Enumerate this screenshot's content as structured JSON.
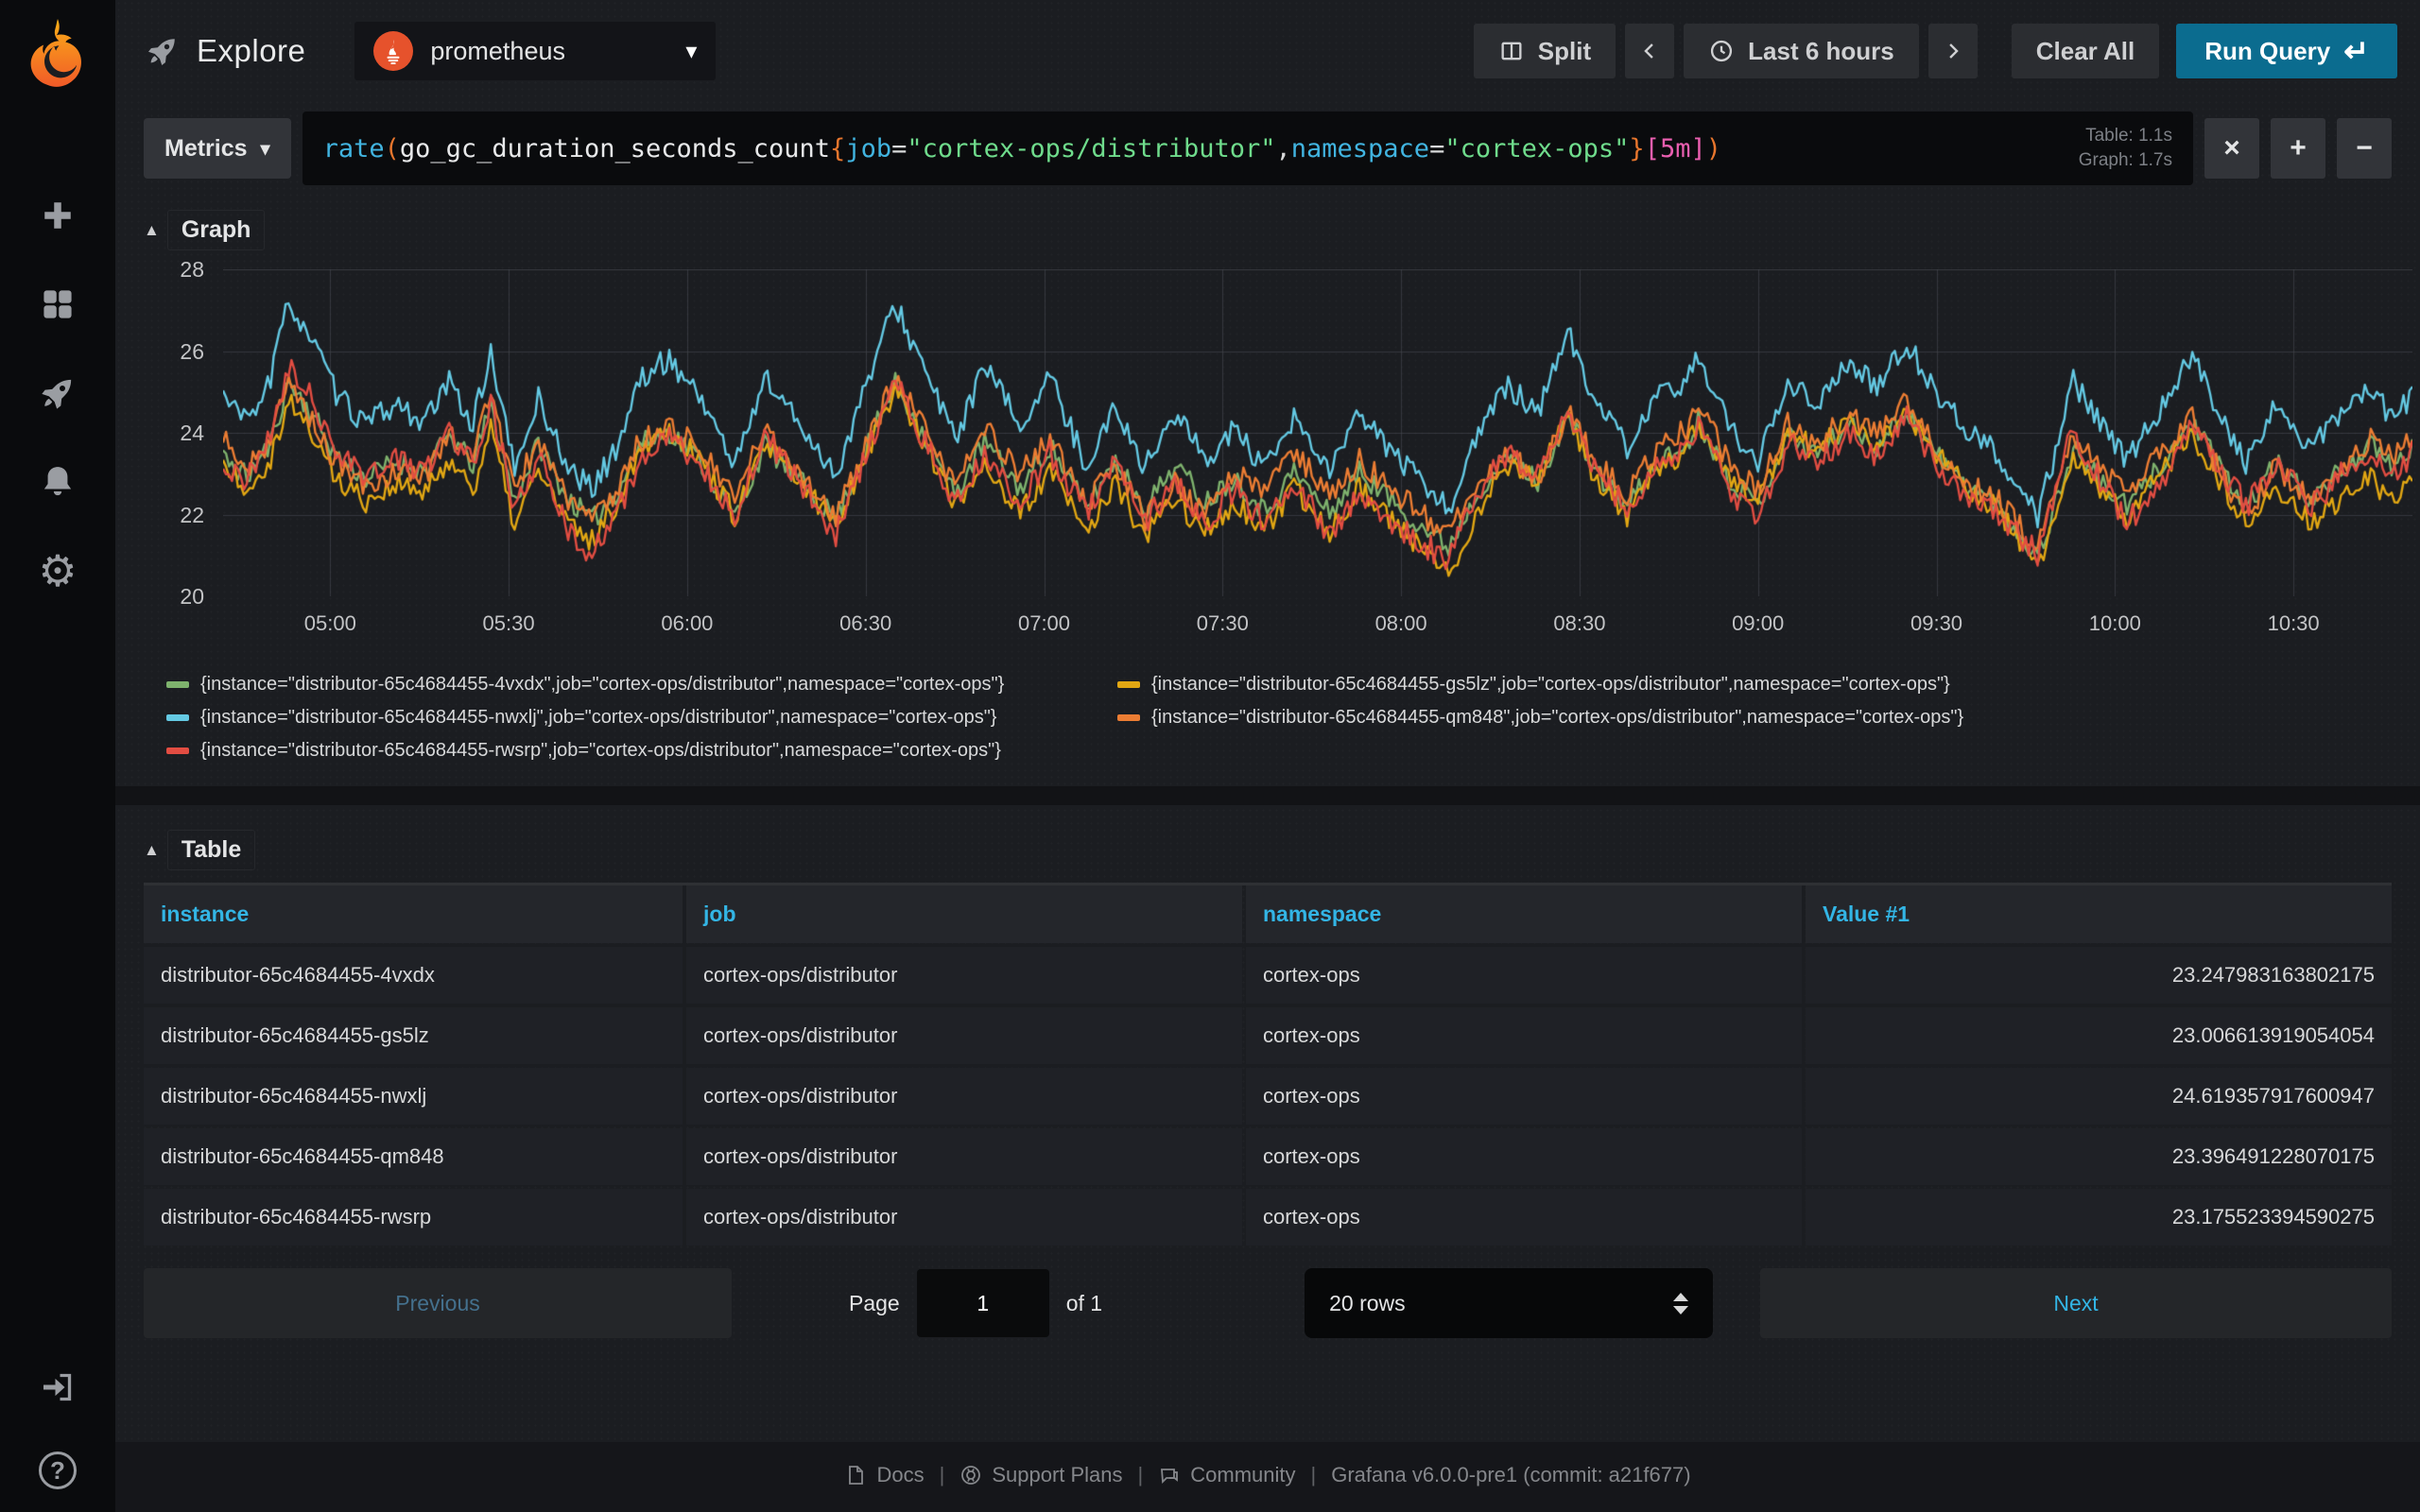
{
  "app": {
    "title": "Explore",
    "datasource": "prometheus"
  },
  "topbar": {
    "split": "Split",
    "time_range": "Last 6 hours",
    "clear_all": "Clear All",
    "run_query": "Run Query",
    "run_query_icon": "↵"
  },
  "query": {
    "mode": "Metrics",
    "mode_caret": "▾",
    "tokens": [
      {
        "t": "rate",
        "c": "func"
      },
      {
        "t": "(",
        "c": "paren"
      },
      {
        "t": "go_gc_duration_seconds_count",
        "c": "metric"
      },
      {
        "t": "{",
        "c": "brace"
      },
      {
        "t": "job",
        "c": "label"
      },
      {
        "t": "=",
        "c": "op"
      },
      {
        "t": "\"cortex-ops/distributor\"",
        "c": "string"
      },
      {
        "t": ",",
        "c": "op"
      },
      {
        "t": "namespace",
        "c": "label"
      },
      {
        "t": "=",
        "c": "op"
      },
      {
        "t": "\"cortex-ops\"",
        "c": "string"
      },
      {
        "t": "}",
        "c": "brace"
      },
      {
        "t": "[5m]",
        "c": "dur"
      },
      {
        "t": ")",
        "c": "paren"
      }
    ],
    "table_time": "Table: 1.1s",
    "graph_time": "Graph: 1.7s",
    "remove_label": "×",
    "add_label": "+",
    "minus_label": "−"
  },
  "graph_section": {
    "collapse_icon": "▲",
    "title": "Graph"
  },
  "chart_data": {
    "type": "line",
    "title": "Graph",
    "ylim": [
      20,
      28
    ],
    "y_ticks": [
      20,
      22,
      24,
      26,
      28
    ],
    "x_ticks": [
      {
        "label": "05:00",
        "minute": 0
      },
      {
        "label": "05:30",
        "minute": 30
      },
      {
        "label": "06:00",
        "minute": 60
      },
      {
        "label": "06:30",
        "minute": 90
      },
      {
        "label": "07:00",
        "minute": 120
      },
      {
        "label": "07:30",
        "minute": 150
      },
      {
        "label": "08:00",
        "minute": 180
      },
      {
        "label": "08:30",
        "minute": 210
      },
      {
        "label": "09:00",
        "minute": 240
      },
      {
        "label": "09:30",
        "minute": 270
      },
      {
        "label": "10:00",
        "minute": 300
      },
      {
        "label": "10:30",
        "minute": 330
      }
    ],
    "x_range_minutes": [
      -18,
      350
    ],
    "grid_color": "#44474e",
    "base_mean": 24.62,
    "anchors": [
      [
        -18,
        24.8
      ],
      [
        -14,
        24.2
      ],
      [
        -10,
        25.2
      ],
      [
        -7,
        27.1
      ],
      [
        -3,
        26.1
      ],
      [
        1,
        24.8
      ],
      [
        6,
        24.1
      ],
      [
        11,
        24.6
      ],
      [
        16,
        24.3
      ],
      [
        20,
        25.4
      ],
      [
        24,
        24.5
      ],
      [
        27,
        26.3
      ],
      [
        31,
        23.3
      ],
      [
        35,
        25.0
      ],
      [
        40,
        23.2
      ],
      [
        44,
        22.6
      ],
      [
        48,
        23.5
      ],
      [
        52,
        25.1
      ],
      [
        57,
        25.6
      ],
      [
        62,
        24.9
      ],
      [
        68,
        23.3
      ],
      [
        73,
        25.5
      ],
      [
        80,
        24.0
      ],
      [
        85,
        22.9
      ],
      [
        90,
        25.0
      ],
      [
        95,
        27.0
      ],
      [
        100,
        25.3
      ],
      [
        105,
        23.6
      ],
      [
        110,
        25.3
      ],
      [
        116,
        23.9
      ],
      [
        121,
        25.2
      ],
      [
        127,
        23.3
      ],
      [
        132,
        24.7
      ],
      [
        137,
        23.1
      ],
      [
        142,
        24.3
      ],
      [
        147,
        23.2
      ],
      [
        152,
        24.1
      ],
      [
        157,
        23.2
      ],
      [
        162,
        24.4
      ],
      [
        168,
        23.0
      ],
      [
        173,
        24.2
      ],
      [
        178,
        23.4
      ],
      [
        183,
        22.6
      ],
      [
        188,
        21.9
      ],
      [
        193,
        23.8
      ],
      [
        198,
        25.0
      ],
      [
        203,
        24.4
      ],
      [
        208,
        26.4
      ],
      [
        213,
        24.6
      ],
      [
        218,
        23.6
      ],
      [
        223,
        24.9
      ],
      [
        228,
        25.4
      ],
      [
        230,
        26.2
      ],
      [
        235,
        24.4
      ],
      [
        240,
        23.5
      ],
      [
        245,
        25.6
      ],
      [
        250,
        25.0
      ],
      [
        255,
        25.9
      ],
      [
        260,
        25.3
      ],
      [
        265,
        26.3
      ],
      [
        270,
        24.9
      ],
      [
        275,
        23.9
      ],
      [
        280,
        23.4
      ],
      [
        284,
        22.6
      ],
      [
        287,
        22.0
      ],
      [
        293,
        25.4
      ],
      [
        298,
        24.1
      ],
      [
        302,
        23.3
      ],
      [
        307,
        24.3
      ],
      [
        313,
        25.8
      ],
      [
        318,
        24.3
      ],
      [
        322,
        23.2
      ],
      [
        327,
        24.6
      ],
      [
        333,
        23.6
      ],
      [
        338,
        24.4
      ],
      [
        343,
        25.0
      ],
      [
        347,
        24.2
      ],
      [
        350,
        24.9
      ]
    ],
    "series": [
      {
        "name": "{instance=\"distributor-65c4684455-4vxdx\",job=\"cortex-ops/distributor\",namespace=\"cortex-ops\"}",
        "color": "#7EB26D",
        "mean": 23.247983163802175,
        "scale": 0.8,
        "wander": 0.38,
        "jitter": 0.28,
        "seed": 11
      },
      {
        "name": "{instance=\"distributor-65c4684455-gs5lz\",job=\"cortex-ops/distributor\",namespace=\"cortex-ops\"}",
        "color": "#E2A713",
        "mean": 23.006613919054054,
        "scale": 0.8,
        "wander": 0.45,
        "jitter": 0.3,
        "seed": 22
      },
      {
        "name": "{instance=\"distributor-65c4684455-nwxlj\",job=\"cortex-ops/distributor\",namespace=\"cortex-ops\"}",
        "color": "#64C9E3",
        "mean": 24.619357917600947,
        "scale": 1.0,
        "wander": 0.35,
        "jitter": 0.3,
        "seed": 33
      },
      {
        "name": "{instance=\"distributor-65c4684455-qm848\",job=\"cortex-ops/distributor\",namespace=\"cortex-ops\"}",
        "color": "#EC7D33",
        "mean": 23.396491228070175,
        "scale": 0.8,
        "wander": 0.4,
        "jitter": 0.3,
        "seed": 44
      },
      {
        "name": "{instance=\"distributor-65c4684455-rwsrp\",job=\"cortex-ops/distributor\",namespace=\"cortex-ops\"}",
        "color": "#E24D42",
        "mean": 23.175523394590275,
        "scale": 0.88,
        "wander": 0.42,
        "jitter": 0.32,
        "seed": 55
      }
    ],
    "legend_position": "bottom"
  },
  "table_section": {
    "collapse_icon": "▲",
    "title": "Table",
    "columns": [
      "instance",
      "job",
      "namespace",
      "Value #1"
    ],
    "rows": [
      [
        "distributor-65c4684455-4vxdx",
        "cortex-ops/distributor",
        "cortex-ops",
        "23.247983163802175"
      ],
      [
        "distributor-65c4684455-gs5lz",
        "cortex-ops/distributor",
        "cortex-ops",
        "23.006613919054054"
      ],
      [
        "distributor-65c4684455-nwxlj",
        "cortex-ops/distributor",
        "cortex-ops",
        "24.619357917600947"
      ],
      [
        "distributor-65c4684455-qm848",
        "cortex-ops/distributor",
        "cortex-ops",
        "23.396491228070175"
      ],
      [
        "distributor-65c4684455-rwsrp",
        "cortex-ops/distributor",
        "cortex-ops",
        "23.175523394590275"
      ]
    ]
  },
  "pagination": {
    "previous": "Previous",
    "page_label": "Page",
    "page_value": "1",
    "of_label": "of 1",
    "rows_select": "20 rows",
    "next": "Next"
  },
  "footer": {
    "docs": "Docs",
    "support": "Support Plans",
    "community": "Community",
    "version": "Grafana v6.0.0-pre1 (commit: a21f677)",
    "separator": "|"
  },
  "colors": {
    "accent_blue": "#33b5e5",
    "run_query_bg": "#0b6c8f",
    "prometheus_orange": "#e6522c",
    "grafana_orange": "#f05a28"
  }
}
